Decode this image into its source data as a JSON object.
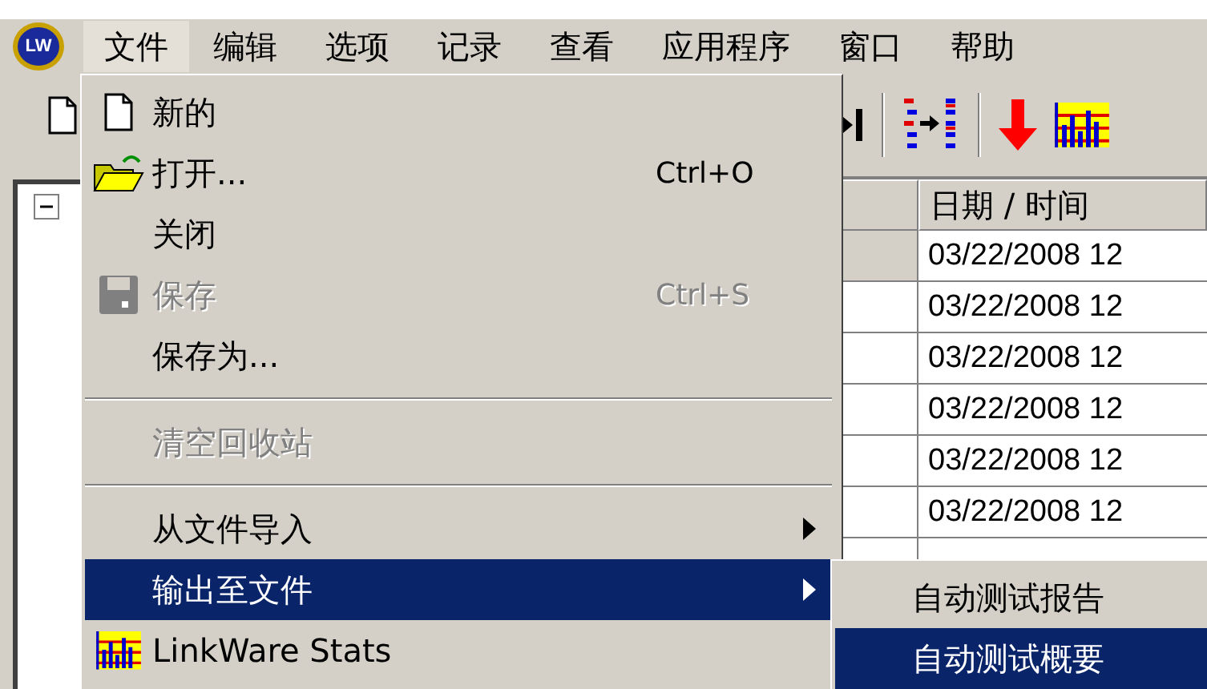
{
  "logo": "LW",
  "menubar": [
    {
      "label": "文件",
      "selected": true
    },
    {
      "label": "编辑",
      "selected": false
    },
    {
      "label": "选项",
      "selected": false
    },
    {
      "label": "记录",
      "selected": false
    },
    {
      "label": "查看",
      "selected": false
    },
    {
      "label": "应用程序",
      "selected": false
    },
    {
      "label": "窗口",
      "selected": false
    },
    {
      "label": "帮助",
      "selected": false
    }
  ],
  "tree": {
    "expanded": true
  },
  "file_menu": [
    {
      "kind": "item",
      "label": "新的",
      "disabled": false,
      "selected": false
    },
    {
      "kind": "item",
      "label": "打开...",
      "shortcut": "Ctrl+O",
      "disabled": false,
      "selected": false
    },
    {
      "kind": "item",
      "label": "关闭",
      "disabled": false,
      "selected": false
    },
    {
      "kind": "item",
      "label": "保存",
      "shortcut": "Ctrl+S",
      "disabled": true,
      "selected": false
    },
    {
      "kind": "item",
      "label": "保存为...",
      "disabled": false,
      "selected": false
    },
    {
      "kind": "separator"
    },
    {
      "kind": "item",
      "label": "清空回收站",
      "disabled": true,
      "selected": false
    },
    {
      "kind": "separator"
    },
    {
      "kind": "submenu",
      "label": "从文件导入",
      "disabled": false,
      "selected": false
    },
    {
      "kind": "submenu",
      "label": "输出至文件",
      "disabled": false,
      "selected": true
    },
    {
      "kind": "item",
      "label": "LinkWare Stats",
      "disabled": false,
      "selected": false
    }
  ],
  "submenu": [
    {
      "label": "自动测试报告",
      "selected": false
    },
    {
      "label": "自动测试概要",
      "selected": true
    }
  ],
  "table": {
    "columns": [
      "日期 / 时间"
    ],
    "rows": [
      {
        "date": "03/22/2008 12",
        "selected": true
      },
      {
        "date": "03/22/2008 12",
        "selected": false
      },
      {
        "date": "03/22/2008 12",
        "selected": false
      },
      {
        "date": "03/22/2008 12",
        "selected": false
      },
      {
        "date": "03/22/2008 12",
        "selected": false
      },
      {
        "date": "03/22/2008 12",
        "selected": false
      }
    ]
  }
}
